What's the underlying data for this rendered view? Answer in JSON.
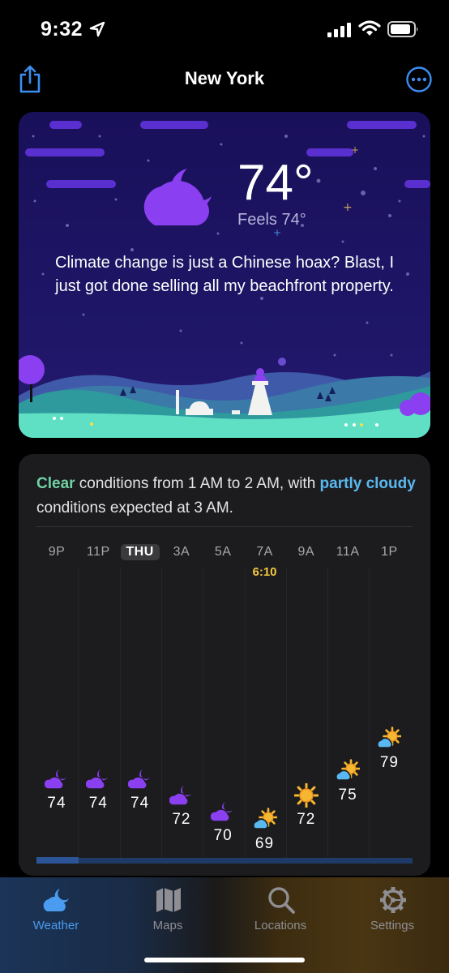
{
  "status_bar": {
    "time": "9:32",
    "icons": [
      "location-arrow-icon",
      "cellular-signal-icon",
      "wifi-icon",
      "battery-icon"
    ]
  },
  "nav": {
    "title": "New York",
    "left_icon": "share-icon",
    "right_icon": "more-icon"
  },
  "hero": {
    "temperature": "74°",
    "feels_like": "Feels 74°",
    "quote": "Climate change is just a Chinese hoax? Blast, I just got done selling all my beachfront property.",
    "condition_icon": "partly-cloudy-night-icon"
  },
  "forecast": {
    "summary": {
      "part1": "Clear",
      "part2": " conditions from 1 AM to 2 AM, with ",
      "part3": "partly cloudy",
      "part4": " conditions expected at 3 AM."
    },
    "hours": [
      {
        "label": "9P",
        "temp": "74",
        "icon": "partly-cloudy-night-icon",
        "current": false
      },
      {
        "label": "11P",
        "temp": "74",
        "icon": "partly-cloudy-night-icon",
        "current": false
      },
      {
        "label": "THU",
        "temp": "74",
        "icon": "partly-cloudy-night-icon",
        "current": true
      },
      {
        "label": "3A",
        "temp": "72",
        "icon": "partly-cloudy-night-icon",
        "current": false
      },
      {
        "label": "5A",
        "temp": "70",
        "icon": "partly-cloudy-night-icon",
        "current": false
      },
      {
        "label": "7A",
        "temp": "69",
        "icon": "partly-cloudy-day-icon",
        "current": false
      },
      {
        "label": "9A",
        "temp": "72",
        "icon": "sunny-icon",
        "current": false
      },
      {
        "label": "11A",
        "temp": "75",
        "icon": "partly-cloudy-day-icon",
        "current": false
      },
      {
        "label": "1P",
        "temp": "79",
        "icon": "partly-cloudy-day-icon",
        "current": false
      }
    ],
    "sunrise": "6:10",
    "colors": {
      "green": "#6fd2a4",
      "blue": "#5ab8f0",
      "sunrise": "#f5c842",
      "moon": "#8a3ff0"
    }
  },
  "tabs": [
    {
      "label": "Weather",
      "icon": "weather-icon",
      "active": true
    },
    {
      "label": "Maps",
      "icon": "map-icon",
      "active": false
    },
    {
      "label": "Locations",
      "icon": "search-icon",
      "active": false
    },
    {
      "label": "Settings",
      "icon": "gear-icon",
      "active": false
    }
  ]
}
